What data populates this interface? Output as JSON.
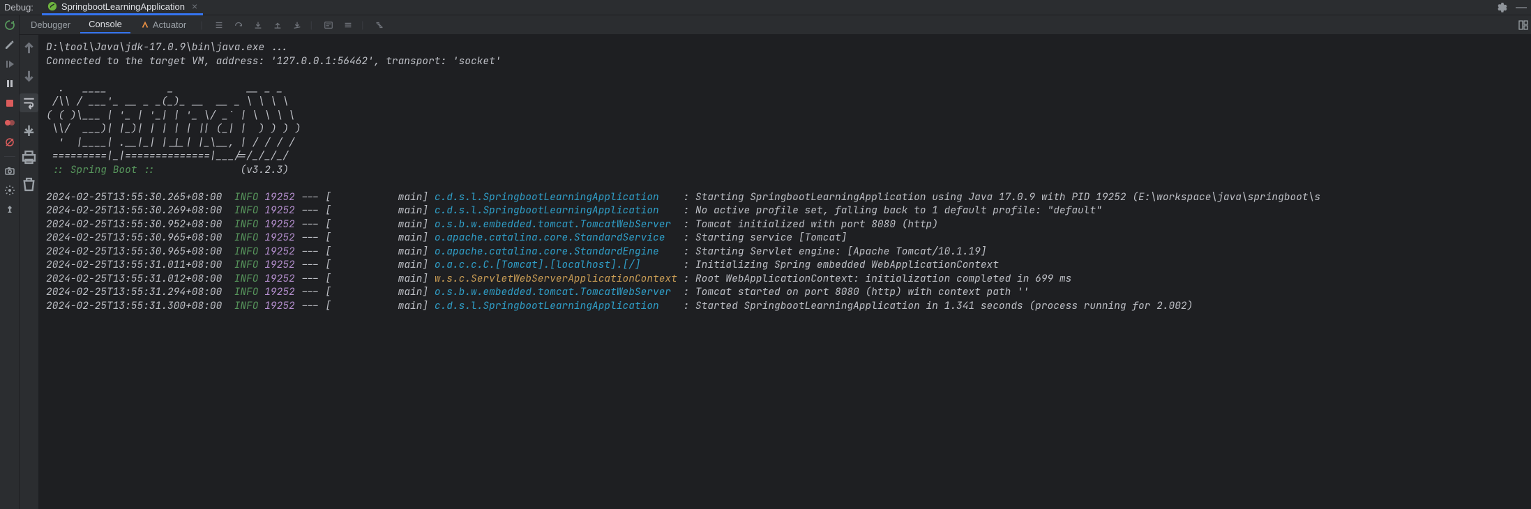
{
  "topbar": {
    "label": "Debug:",
    "tabName": "SpringbootLearningApplication"
  },
  "tooltabs": {
    "debugger": "Debugger",
    "console": "Console",
    "actuator": "Actuator"
  },
  "console": {
    "line1": "D:\\tool\\Java\\jdk-17.0.9\\bin\\java.exe ...",
    "line2": "Connected to the target VM, address: '127.0.0.1:56462', transport: 'socket'",
    "banner1": "  .   ____          _            __ _ _",
    "banner2": " /\\\\ / ___'_ __ _ _(_)_ __  __ _ \\ \\ \\ \\",
    "banner3": "( ( )\\___ | '_ | '_| | '_ \\/ _` | \\ \\ \\ \\",
    "banner4": " \\\\/  ___)| |_)| | | | | || (_| |  ) ) ) )",
    "banner5": "  '  |____| .__|_| |_|_| |_\\__, | / / / /",
    "banner6": " =========|_|==============|___/=/_/_/_/",
    "bootLabel": " :: Spring Boot :: ",
    "bootVersion": "             (v3.2.3)",
    "logs": [
      {
        "ts": "2024-02-25T13:55:30.265+08:00",
        "lvl": "INFO",
        "pid": "19252",
        "sep": " --- [           main] ",
        "logger": "c.d.s.l.SpringbootLearningApplication   ",
        "cls": "c-logger",
        "msg": " : Starting SpringbootLearningApplication using Java 17.0.9 with PID 19252 (E:\\workspace\\java\\springboot\\s"
      },
      {
        "ts": "2024-02-25T13:55:30.269+08:00",
        "lvl": "INFO",
        "pid": "19252",
        "sep": " --- [           main] ",
        "logger": "c.d.s.l.SpringbootLearningApplication   ",
        "cls": "c-logger",
        "msg": " : No active profile set, falling back to 1 default profile: \"default\""
      },
      {
        "ts": "2024-02-25T13:55:30.952+08:00",
        "lvl": "INFO",
        "pid": "19252",
        "sep": " --- [           main] ",
        "logger": "o.s.b.w.embedded.tomcat.TomcatWebServer ",
        "cls": "c-logger",
        "msg": " : Tomcat initialized with port 8080 (http)"
      },
      {
        "ts": "2024-02-25T13:55:30.965+08:00",
        "lvl": "INFO",
        "pid": "19252",
        "sep": " --- [           main] ",
        "logger": "o.apache.catalina.core.StandardService  ",
        "cls": "c-logger",
        "msg": " : Starting service [Tomcat]"
      },
      {
        "ts": "2024-02-25T13:55:30.965+08:00",
        "lvl": "INFO",
        "pid": "19252",
        "sep": " --- [           main] ",
        "logger": "o.apache.catalina.core.StandardEngine   ",
        "cls": "c-logger",
        "msg": " : Starting Servlet engine: [Apache Tomcat/10.1.19]"
      },
      {
        "ts": "2024-02-25T13:55:31.011+08:00",
        "lvl": "INFO",
        "pid": "19252",
        "sep": " --- [           main] ",
        "logger": "o.a.c.c.C.[Tomcat].[localhost].[/]      ",
        "cls": "c-logger",
        "msg": " : Initializing Spring embedded WebApplicationContext"
      },
      {
        "ts": "2024-02-25T13:55:31.012+08:00",
        "lvl": "INFO",
        "pid": "19252",
        "sep": " --- [           main] ",
        "logger": "w.s.c.ServletWebServerApplicationContext",
        "cls": "c-logger2",
        "msg": " : Root WebApplicationContext: initialization completed in 699 ms"
      },
      {
        "ts": "2024-02-25T13:55:31.294+08:00",
        "lvl": "INFO",
        "pid": "19252",
        "sep": " --- [           main] ",
        "logger": "o.s.b.w.embedded.tomcat.TomcatWebServer ",
        "cls": "c-logger",
        "msg": " : Tomcat started on port 8080 (http) with context path ''"
      },
      {
        "ts": "2024-02-25T13:55:31.300+08:00",
        "lvl": "INFO",
        "pid": "19252",
        "sep": " --- [           main] ",
        "logger": "c.d.s.l.SpringbootLearningApplication   ",
        "cls": "c-logger",
        "msg": " : Started SpringbootLearningApplication in 1.341 seconds (process running for 2.002)"
      }
    ]
  }
}
